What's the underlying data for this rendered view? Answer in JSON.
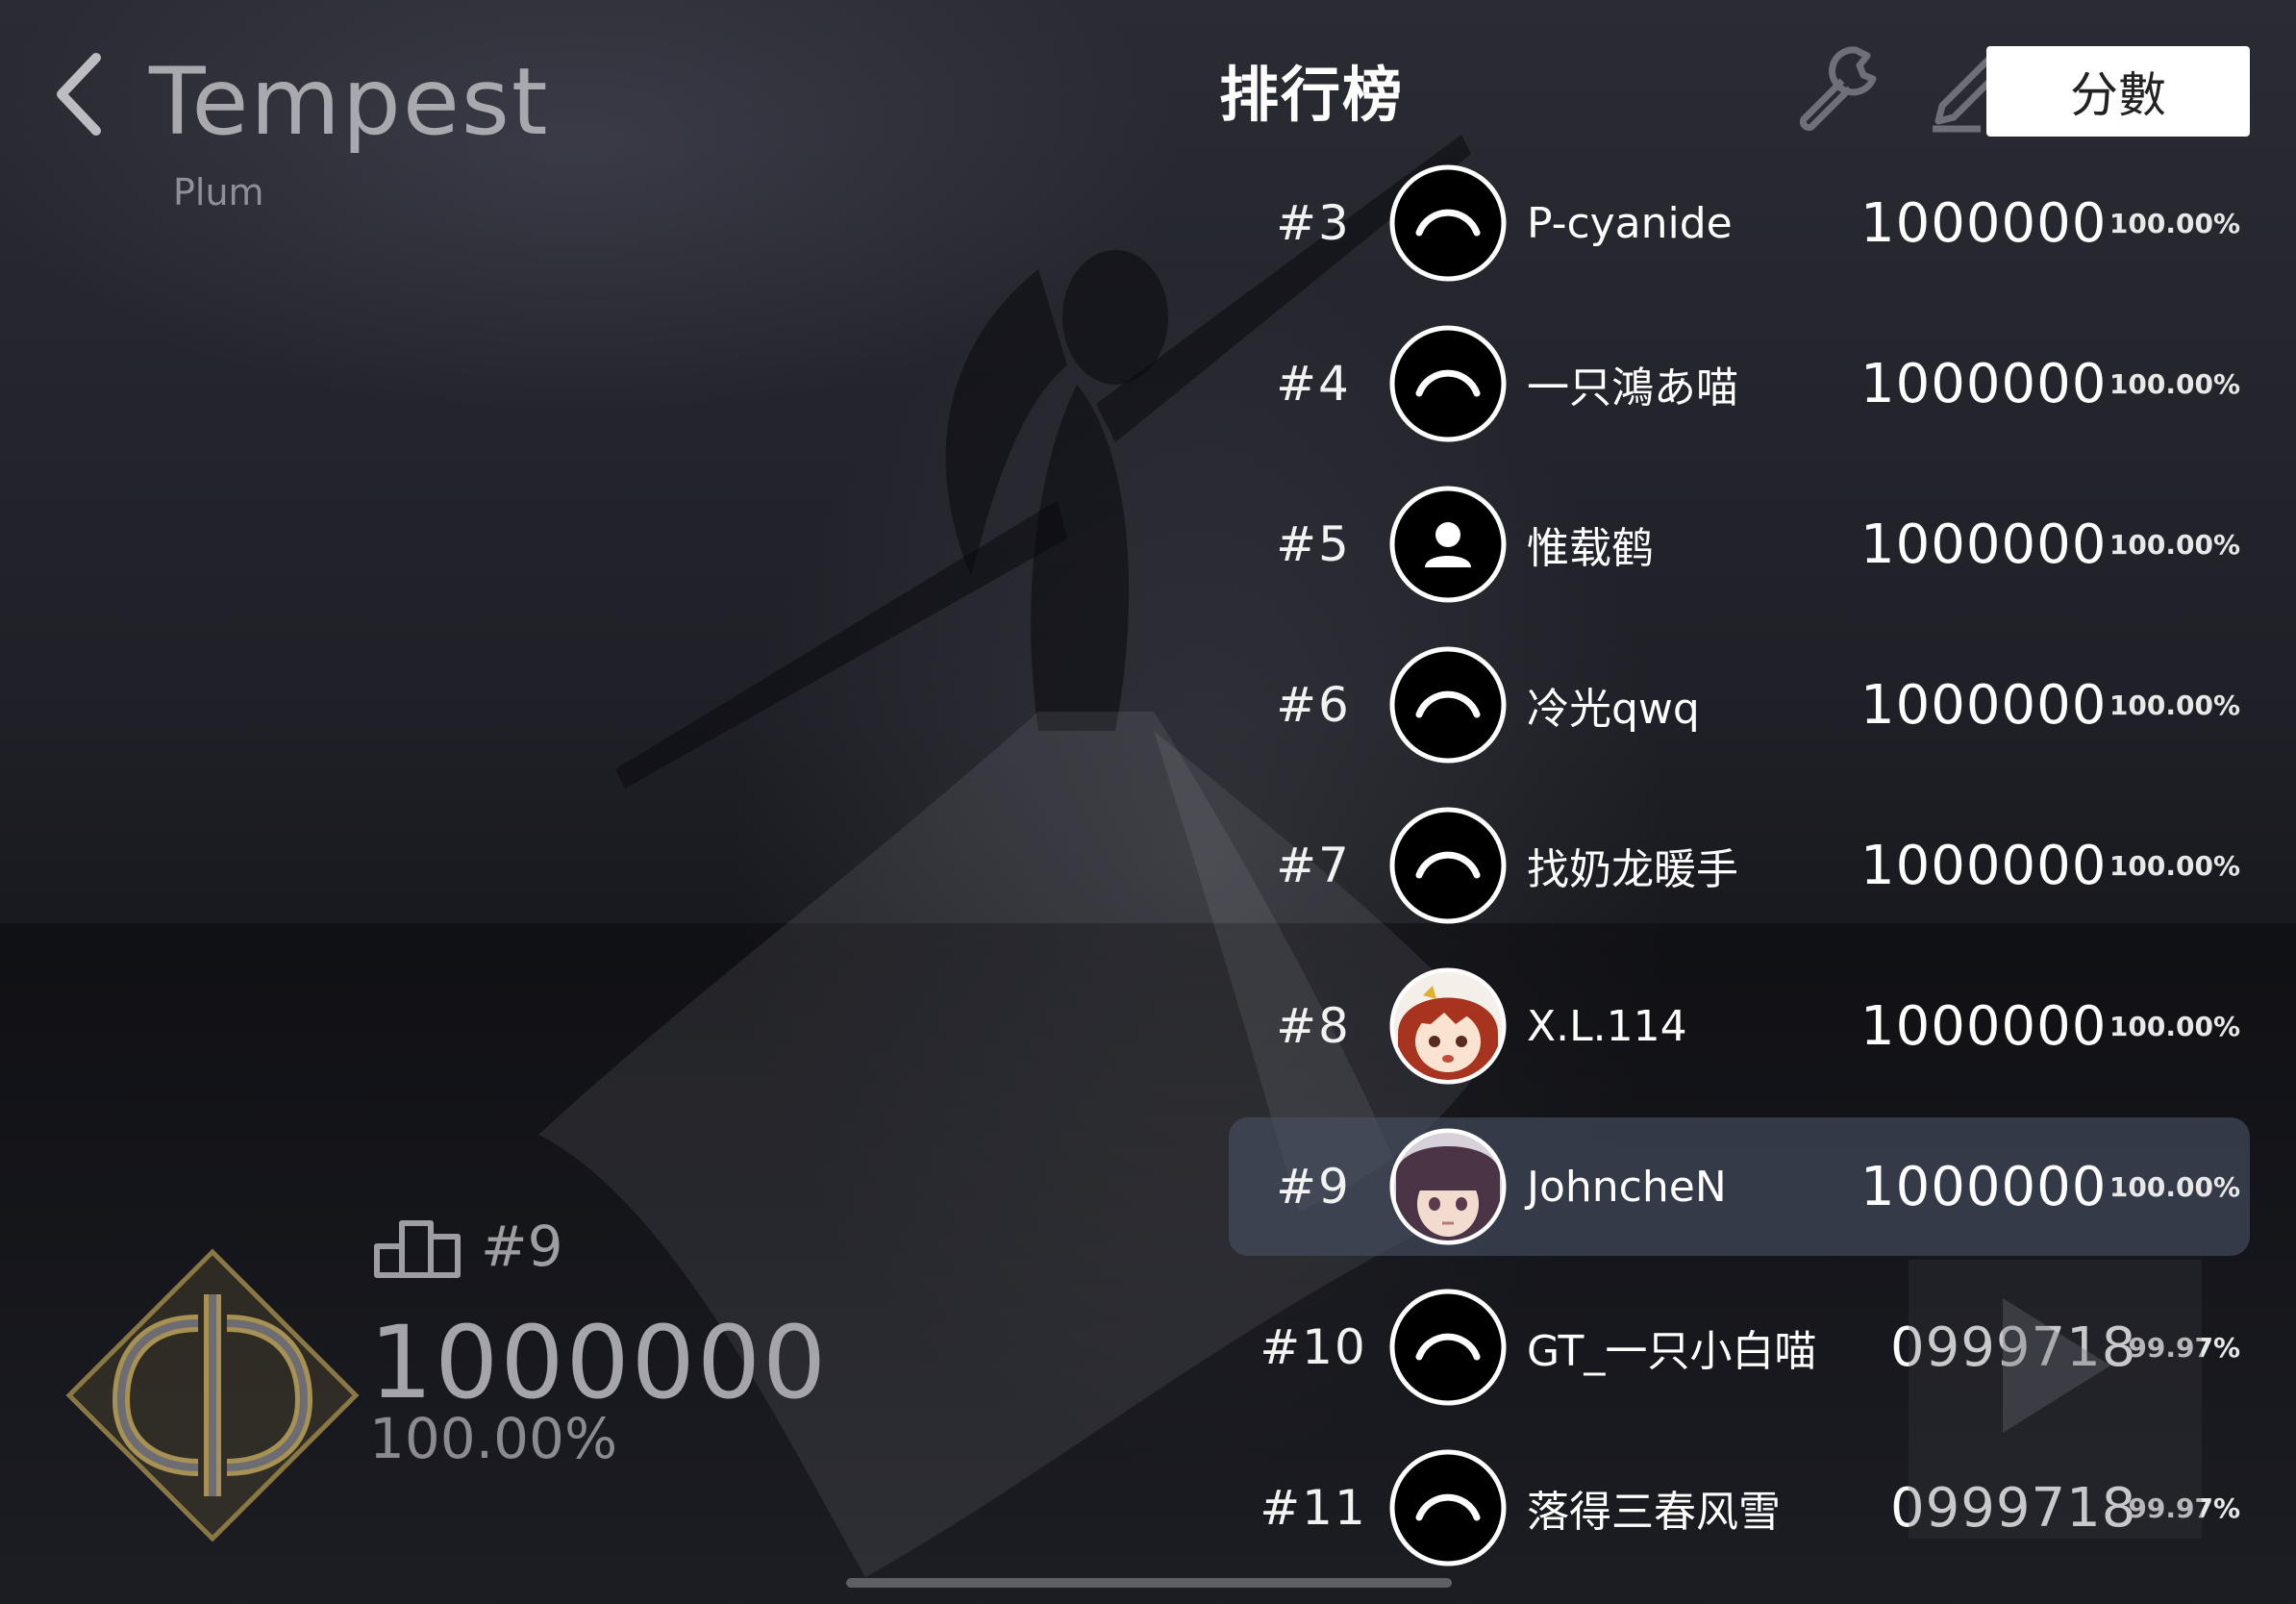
{
  "song": {
    "title": "Tempest",
    "artist": "Plum"
  },
  "header": {
    "board_title": "排行榜",
    "score_button": "分數"
  },
  "my_result": {
    "rank": "#9",
    "score": "1000000",
    "accuracy": "100.00%"
  },
  "leaderboard": [
    {
      "rank": "#3",
      "name": "P-cyanide",
      "score": "1000000",
      "accuracy": "100.00%",
      "avatar": "default-arc-icon"
    },
    {
      "rank": "#4",
      "name": "一只鴻あ喵",
      "score": "1000000",
      "accuracy": "100.00%",
      "avatar": "default-arc-icon"
    },
    {
      "rank": "#5",
      "name": "惟载鹤",
      "score": "1000000",
      "accuracy": "100.00%",
      "avatar": "user-silhouette-icon"
    },
    {
      "rank": "#6",
      "name": "冷光qwq",
      "score": "1000000",
      "accuracy": "100.00%",
      "avatar": "default-arc-icon"
    },
    {
      "rank": "#7",
      "name": "找奶龙暖手",
      "score": "1000000",
      "accuracy": "100.00%",
      "avatar": "default-arc-icon"
    },
    {
      "rank": "#8",
      "name": "X.L.114",
      "score": "1000000",
      "accuracy": "100.00%",
      "avatar": "anime-red-hair-avatar"
    },
    {
      "rank": "#9",
      "name": "JohncheN",
      "score": "1000000",
      "accuracy": "100.00%",
      "avatar": "anime-dark-hair-avatar",
      "highlight": true
    },
    {
      "rank": "#10",
      "name": "GT_一只小白喵",
      "score": "0999718",
      "accuracy": "99.97%",
      "avatar": "default-arc-icon"
    },
    {
      "rank": "#11",
      "name": "落得三春风雪",
      "score": "0999718",
      "accuracy": "99.97%",
      "avatar": "default-arc-icon"
    }
  ],
  "icons": {
    "back": "chevron-left-icon",
    "tool": "wrench-icon",
    "edit": "pen-icon",
    "rank": "podium-icon",
    "grade": "phi-grade-badge",
    "play": "play-icon"
  },
  "colors": {
    "highlight_row": "#485064",
    "grade_gold": "#b8a060"
  }
}
